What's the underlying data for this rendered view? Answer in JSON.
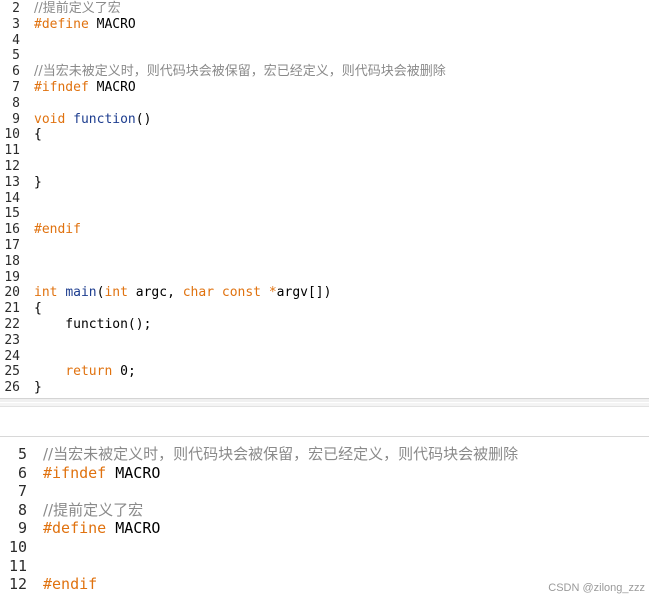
{
  "top_editor": {
    "lines": [
      {
        "n": "2",
        "tokens": [
          {
            "t": "comment",
            "v": "//提前定义了宏"
          }
        ]
      },
      {
        "n": "3",
        "tokens": [
          {
            "t": "pre",
            "v": "#define"
          },
          {
            "t": "plain",
            "v": " MACRO"
          }
        ]
      },
      {
        "n": "4",
        "tokens": []
      },
      {
        "n": "5",
        "tokens": []
      },
      {
        "n": "6",
        "tokens": [
          {
            "t": "comment",
            "v": "//当宏未被定义时，则代码块会被保留，宏已经定义，则代码块会被删除"
          }
        ]
      },
      {
        "n": "7",
        "tokens": [
          {
            "t": "pre",
            "v": "#ifndef"
          },
          {
            "t": "plain",
            "v": " MACRO"
          }
        ]
      },
      {
        "n": "8",
        "tokens": []
      },
      {
        "n": "9",
        "tokens": [
          {
            "t": "kw",
            "v": "void"
          },
          {
            "t": "plain",
            "v": " "
          },
          {
            "t": "fn",
            "v": "function"
          },
          {
            "t": "plain",
            "v": "()"
          }
        ]
      },
      {
        "n": "10",
        "tokens": [
          {
            "t": "plain",
            "v": "{"
          }
        ]
      },
      {
        "n": "11",
        "tokens": []
      },
      {
        "n": "12",
        "tokens": []
      },
      {
        "n": "13",
        "tokens": [
          {
            "t": "plain",
            "v": "}"
          }
        ]
      },
      {
        "n": "14",
        "tokens": []
      },
      {
        "n": "15",
        "tokens": []
      },
      {
        "n": "16",
        "tokens": [
          {
            "t": "pre",
            "v": "#endif"
          }
        ]
      },
      {
        "n": "17",
        "tokens": []
      },
      {
        "n": "18",
        "tokens": []
      },
      {
        "n": "19",
        "tokens": []
      },
      {
        "n": "20",
        "tokens": [
          {
            "t": "kw",
            "v": "int"
          },
          {
            "t": "plain",
            "v": " "
          },
          {
            "t": "fn",
            "v": "main"
          },
          {
            "t": "plain",
            "v": "("
          },
          {
            "t": "kw",
            "v": "int"
          },
          {
            "t": "plain",
            "v": " argc, "
          },
          {
            "t": "kw",
            "v": "char"
          },
          {
            "t": "plain",
            "v": " "
          },
          {
            "t": "kw",
            "v": "const"
          },
          {
            "t": "plain",
            "v": " "
          },
          {
            "t": "kw",
            "v": "*"
          },
          {
            "t": "plain",
            "v": "argv[])"
          }
        ]
      },
      {
        "n": "21",
        "tokens": [
          {
            "t": "plain",
            "v": "{"
          }
        ]
      },
      {
        "n": "22",
        "tokens": [
          {
            "t": "plain",
            "v": "    function();"
          }
        ]
      },
      {
        "n": "23",
        "tokens": []
      },
      {
        "n": "24",
        "tokens": []
      },
      {
        "n": "25",
        "tokens": [
          {
            "t": "plain",
            "v": "    "
          },
          {
            "t": "kw",
            "v": "return"
          },
          {
            "t": "plain",
            "v": " "
          },
          {
            "t": "num",
            "v": "0"
          },
          {
            "t": "plain",
            "v": ";"
          }
        ]
      },
      {
        "n": "26",
        "tokens": [
          {
            "t": "plain",
            "v": "}"
          }
        ]
      }
    ]
  },
  "bottom_editor": {
    "lines": [
      {
        "n": "5",
        "tokens": [
          {
            "t": "comment",
            "v": "//当宏未被定义时，则代码块会被保留，宏已经定义，则代码块会被删除"
          }
        ]
      },
      {
        "n": "6",
        "tokens": [
          {
            "t": "pre",
            "v": "#ifndef"
          },
          {
            "t": "plain",
            "v": " MACRO"
          }
        ]
      },
      {
        "n": "7",
        "tokens": []
      },
      {
        "n": "8",
        "tokens": [
          {
            "t": "comment",
            "v": "//提前定义了宏"
          }
        ]
      },
      {
        "n": "9",
        "tokens": [
          {
            "t": "pre",
            "v": "#define"
          },
          {
            "t": "plain",
            "v": " MACRO"
          }
        ]
      },
      {
        "n": "10",
        "tokens": []
      },
      {
        "n": "11",
        "tokens": []
      },
      {
        "n": "12",
        "tokens": [
          {
            "t": "pre",
            "v": "#endif"
          }
        ]
      }
    ]
  },
  "watermark": "CSDN @zilong_zzz",
  "colors": {
    "comment": "#8a8a8a",
    "preprocessor": "#e0720f",
    "keyword": "#e0720f",
    "function": "#1d3d8f",
    "plain": "#000000"
  }
}
